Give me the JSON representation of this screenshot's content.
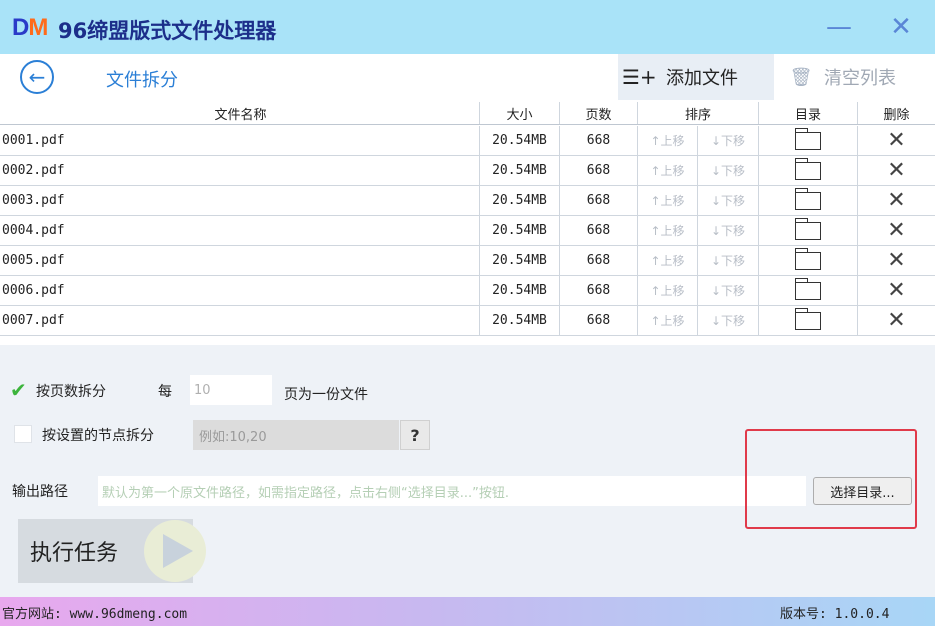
{
  "app": {
    "logo_d": "D",
    "logo_m": "M",
    "title": "96缔盟版式文件处理器",
    "minimize_glyph": "—",
    "close_glyph": "✕"
  },
  "header": {
    "back_icon": "arrow-left-icon",
    "page_title": "文件拆分",
    "add_file": "添加文件",
    "clear_list": "清空列表"
  },
  "table": {
    "columns": {
      "name": "文件名称",
      "size": "大小",
      "pages": "页数",
      "sort": "排序",
      "dir": "目录",
      "delete": "删除"
    },
    "move_up": "↑上移",
    "move_down": "↓下移",
    "rows": [
      {
        "name": "0001.pdf",
        "size": "20.54MB",
        "pages": "668"
      },
      {
        "name": "0002.pdf",
        "size": "20.54MB",
        "pages": "668"
      },
      {
        "name": "0003.pdf",
        "size": "20.54MB",
        "pages": "668"
      },
      {
        "name": "0004.pdf",
        "size": "20.54MB",
        "pages": "668"
      },
      {
        "name": "0005.pdf",
        "size": "20.54MB",
        "pages": "668"
      },
      {
        "name": "0006.pdf",
        "size": "20.54MB",
        "pages": "668"
      },
      {
        "name": "0007.pdf",
        "size": "20.54MB",
        "pages": "668"
      }
    ]
  },
  "options": {
    "split_by_pages": {
      "label": "按页数拆分",
      "checked": true,
      "every": "每",
      "value": "10",
      "suffix": "页为一份文件"
    },
    "split_by_nodes": {
      "label": "按设置的节点拆分",
      "checked": false,
      "placeholder": "例如:10,20",
      "help": "?"
    }
  },
  "output": {
    "label": "输出路径",
    "placeholder": "默认为第一个原文件路径，如需指定路径，点击右侧“选择目录...”按钮.",
    "choose_button": "选择目录..."
  },
  "run": {
    "label": "执行任务"
  },
  "footer": {
    "site": "官方网站:  www.96dmeng.com",
    "version": "版本号: 1.0.0.4"
  },
  "colors": {
    "titlebar": "#a9e3f8",
    "accent": "#2b7fd6",
    "highlight": "#e03a4a",
    "check": "#3cb43c"
  }
}
